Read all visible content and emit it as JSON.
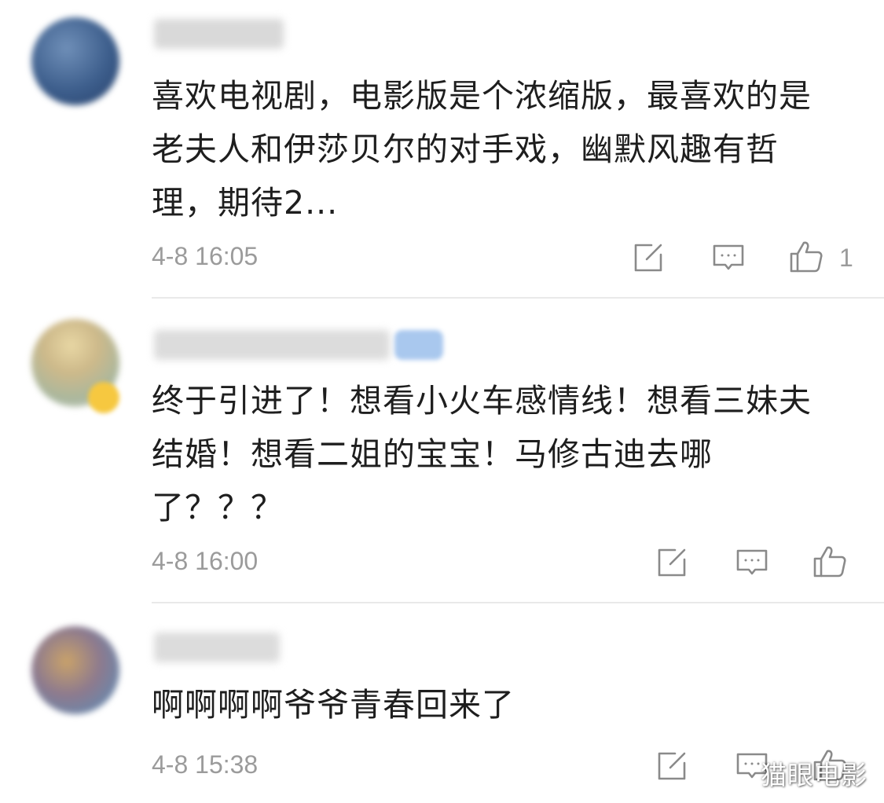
{
  "comments": [
    {
      "text": "喜欢电视剧，电影版是个浓缩版，最喜欢的是老夫人和伊莎贝尔的对手戏，幽默风趣有哲理，期待2...",
      "time": "4-8 16:05",
      "like_count": "1"
    },
    {
      "text": "终于引进了！想看小火车感情线！想看三妹夫结婚！想看二姐的宝宝！马修古迪去哪了？？？",
      "time": "4-8 16:00",
      "like_count": ""
    },
    {
      "text": "啊啊啊啊爷爷青春回来了",
      "time": "4-8 15:38",
      "like_count": ""
    }
  ],
  "icons": {
    "edit": "edit-icon",
    "reply": "comment-icon",
    "like": "thumbs-up-icon"
  },
  "watermark": "猫眼电影",
  "colors": {
    "text": "#1e1e1e",
    "meta": "#9b9b9b",
    "icon": "#8a8a8a",
    "divider": "#e9e9e9"
  }
}
